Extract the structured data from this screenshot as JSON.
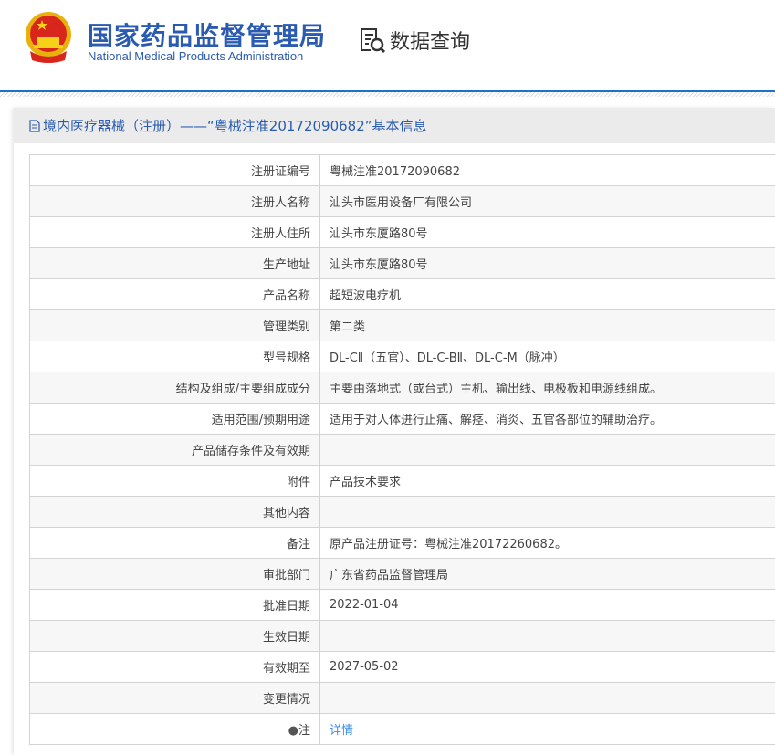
{
  "header": {
    "title_cn": "国家药品监督管理局",
    "title_en": "National Medical Products Administration",
    "query_label": "数据查询"
  },
  "panel": {
    "title": "境内医疗器械（注册）——“粤械注准20172090682”基本信息"
  },
  "rows": [
    {
      "label": "注册证编号",
      "value": "粤械注准20172090682"
    },
    {
      "label": "注册人名称",
      "value": "汕头市医用设备厂有限公司"
    },
    {
      "label": "注册人住所",
      "value": "汕头市东厦路80号"
    },
    {
      "label": "生产地址",
      "value": "汕头市东厦路80号"
    },
    {
      "label": "产品名称",
      "value": "超短波电疗机"
    },
    {
      "label": "管理类别",
      "value": "第二类"
    },
    {
      "label": "型号规格",
      "value": "DL-CⅡ（五官）、DL-C-BⅡ、DL-C-M（脉冲）"
    },
    {
      "label": "结构及组成/主要组成成分",
      "value": "主要由落地式（或台式）主机、输出线、电极板和电源线组成。"
    },
    {
      "label": "适用范围/预期用途",
      "value": "适用于对人体进行止痛、解痉、消炎、五官各部位的辅助治疗。"
    },
    {
      "label": "产品储存条件及有效期",
      "value": ""
    },
    {
      "label": "附件",
      "value": "产品技术要求"
    },
    {
      "label": "其他内容",
      "value": ""
    },
    {
      "label": "备注",
      "value": "原产品注册证号：粤械注准20172260682。"
    },
    {
      "label": "审批部门",
      "value": "广东省药品监督管理局"
    },
    {
      "label": "批准日期",
      "value": "2022-01-04"
    },
    {
      "label": "生效日期",
      "value": ""
    },
    {
      "label": "有效期至",
      "value": "2027-05-02"
    },
    {
      "label": "变更情况",
      "value": ""
    }
  ],
  "note": {
    "label": "注",
    "link": "详情"
  }
}
